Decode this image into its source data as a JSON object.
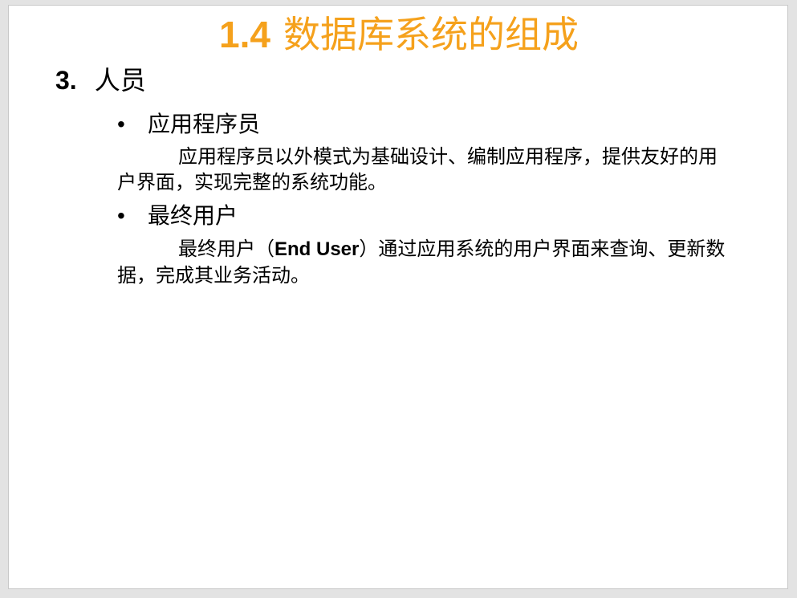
{
  "colors": {
    "title": "#f5a11c",
    "text": "#000000",
    "background": "#ffffff"
  },
  "slide": {
    "title_number": "1.4",
    "title_text": "数据库系统的组成",
    "section_number": "3.",
    "section_label": "人员",
    "items": [
      {
        "bullet": "•",
        "heading": "应用程序员",
        "paragraph": "应用程序员以外模式为基础设计、编制应用程序，提供友好的用户界面，实现完整的系统功能。"
      },
      {
        "bullet": "•",
        "heading": "最终用户",
        "paragraph_before": "最终用户（",
        "paragraph_latin": "End User",
        "paragraph_after": "）通过应用系统的用户界面来查询、更新数据，完成其业务活动。"
      }
    ]
  }
}
